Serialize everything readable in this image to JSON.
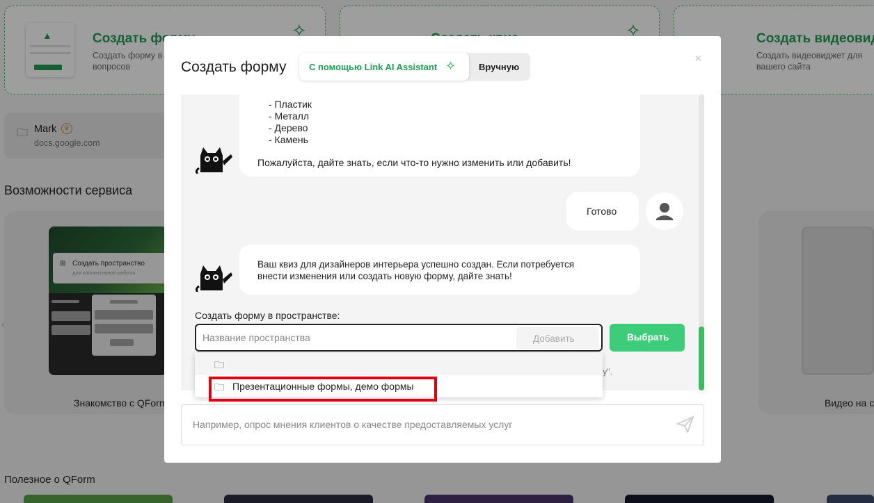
{
  "background": {
    "cards": [
      {
        "title": "Создать форму",
        "subtitle_lines": [
          "Создать форму в",
          "вопросов"
        ]
      },
      {
        "title": "Создать квиз",
        "subtitle_lines": [
          "",
          ""
        ]
      },
      {
        "title": "Создать видеовидж",
        "subtitle_lines": [
          "Создать видеовиджет для",
          "вашего сайта"
        ]
      }
    ],
    "account": {
      "name": "Mark",
      "domain": "docs.google.com"
    },
    "features_title": "Возможности сервиса",
    "feature_preview": {
      "space_title": "Создать пространство",
      "space_subtitle": "для коллективной работы"
    },
    "feature_captions": [
      "Знакомство с QForm",
      "Видео на с"
    ],
    "useful_title": "Полезное о QForm"
  },
  "modal": {
    "title": "Создать форму",
    "mode_ai_label": "С помощью Link AI Assistant",
    "mode_manual_label": "Вручную",
    "close_glyph": "×",
    "chat": {
      "bot_message_1_lines": [
        "- Пластик",
        "- Металл",
        "- Дерево",
        "- Камень",
        "",
        "Пожалуйста, дайте знать, если что-то нужно изменить или добавить!"
      ],
      "user_message": "Готово",
      "bot_message_2_lines": [
        "Ваш квиз для дизайнеров интерьера успешно создан. Если потребуется",
        "внести изменения или создать новую форму, дайте знать!"
      ],
      "space_label": "Создать форму в пространстве:",
      "space_placeholder": "Название пространства",
      "add_label": "Добавить",
      "select_label": "Выбрать",
      "hint_tail": "му\".",
      "dropdown_items": [
        "",
        "Презентационные формы, демо формы"
      ]
    },
    "prompt_placeholder": "Например, опрос мнения клиентов о качестве предоставляемых услуг"
  },
  "colors": {
    "accent": "#1f9d55",
    "button": "#3dcc7a",
    "highlight": "#e0000f"
  },
  "icons": [
    "sparkle-icon",
    "folder-icon",
    "crown-icon",
    "close-icon",
    "cat-bot-avatar-icon",
    "user-avatar-icon",
    "send-icon",
    "chevron-left-icon"
  ]
}
